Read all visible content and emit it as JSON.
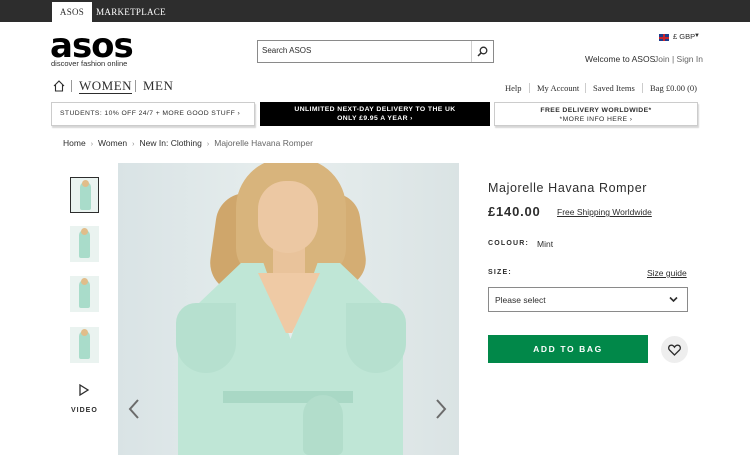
{
  "top_tabs": [
    "ASOS",
    "MARKETPLACE"
  ],
  "logo": {
    "word": "asos",
    "tagline": "discover fashion online"
  },
  "search": {
    "placeholder": "Search ASOS"
  },
  "currency": "£ GBP",
  "account": {
    "welcome": "Welcome to ASOS",
    "join_signin": "Join | Sign In"
  },
  "nav": {
    "women": "WOMEN",
    "men": "MEN"
  },
  "utility_links": [
    "Help",
    "My Account",
    "Saved Items",
    "Bag £0.00 (0)"
  ],
  "promos": {
    "students": "STUDENTS: 10% OFF 24/7 + MORE GOOD STUFF ›",
    "delivery_line1": "UNLIMITED NEXT-DAY DELIVERY TO THE UK",
    "delivery_line2": "ONLY £9.95 A YEAR ›",
    "free_line1": "FREE DELIVERY WORLDWIDE*",
    "free_line2": "*MORE INFO HERE ›"
  },
  "breadcrumb": [
    "Home",
    "Women",
    "New In: Clothing",
    "Majorelle Havana Romper"
  ],
  "gallery": {
    "video_label": "VIDEO"
  },
  "product": {
    "title": "Majorelle Havana Romper",
    "price": "£140.00",
    "shipping": "Free Shipping Worldwide",
    "colour_label": "COLOUR:",
    "colour_value": "Mint",
    "size_label": "SIZE:",
    "size_guide": "Size guide",
    "size_select": "Please select",
    "add_to_bag": "ADD TO BAG"
  },
  "colors": {
    "topbar": "#2d2d2d",
    "add_to_bag": "#018849",
    "dress": "#bfe6d6"
  },
  "icons": [
    "search-icon",
    "uk-flag-icon",
    "home-icon",
    "play-icon",
    "chevron-left-icon",
    "chevron-right-icon",
    "chevron-down-icon",
    "heart-icon"
  ]
}
